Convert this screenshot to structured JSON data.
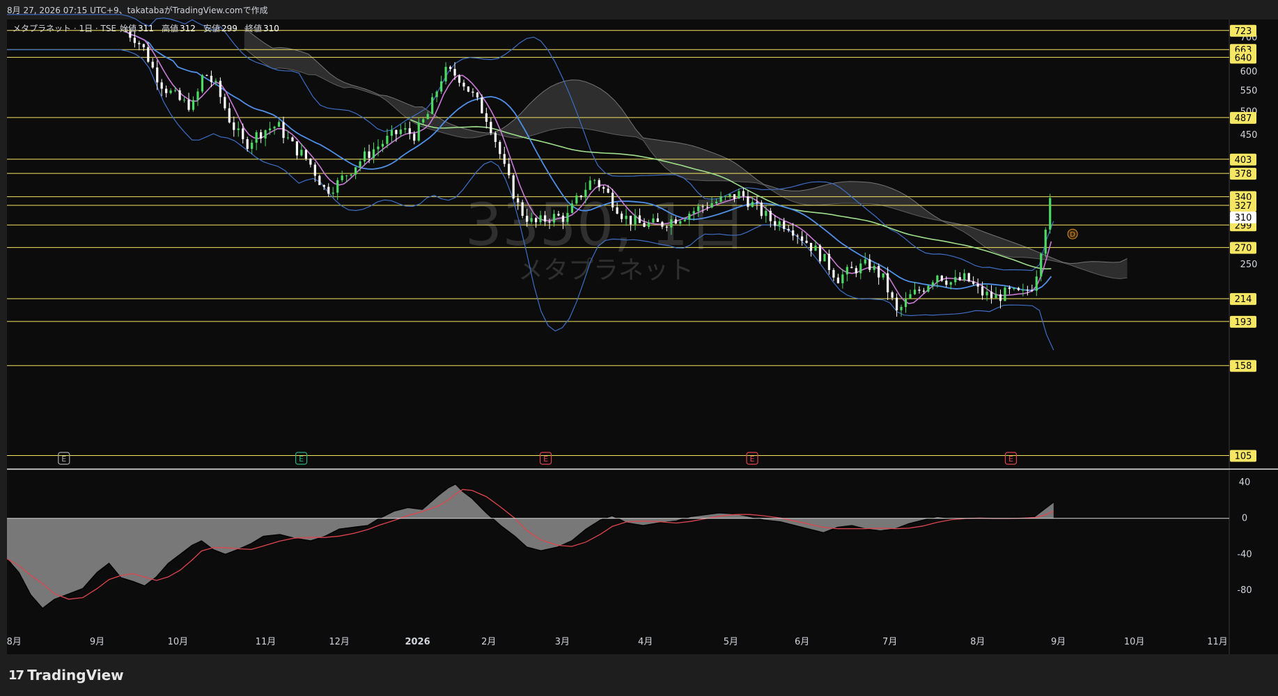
{
  "header": {
    "attribution": "8月 27, 2026 07:15 UTC+9、takatabaがTradingView.comで作成",
    "symbol_line": "メタプラネット · 1日 · TSE",
    "ohlc": [
      {
        "label": "始値",
        "value": "311"
      },
      {
        "label": "高値",
        "value": "312"
      },
      {
        "label": "安値",
        "value": "299"
      },
      {
        "label": "終値",
        "value": "310"
      }
    ]
  },
  "watermark": {
    "line1": "3350, 1日",
    "line2": "メタプラネット"
  },
  "brand": {
    "name": "TradingView",
    "mark": "17"
  },
  "colors": {
    "background": "#0c0c0c",
    "up": "#4cd964",
    "down": "#ffffff",
    "hline": "#f5e663",
    "ma_short": "#c97ad6",
    "ma_mid": "#4f8fe6",
    "ma_long": "#9fde8a",
    "bollinger": "#3e6fc6",
    "cloud": "#8a8a8a",
    "price_tag": "#f5e663",
    "earnings_pos": "#2bb07d",
    "earnings_neg": "#e0454f",
    "earnings_neutral": "#aaaaaa"
  },
  "chart_data": {
    "type": "candlestick",
    "price_axis": {
      "ticks": [
        700,
        600,
        550,
        500,
        450,
        250
      ],
      "min": 105,
      "max": 723,
      "scale": "log"
    },
    "horizontal_levels": [
      {
        "value": 723,
        "label": "723"
      },
      {
        "value": 663,
        "label": "663"
      },
      {
        "value": 640,
        "label": "640"
      },
      {
        "value": 487,
        "label": "487"
      },
      {
        "value": 403,
        "label": "403"
      },
      {
        "value": 378,
        "label": "378"
      },
      {
        "value": 340,
        "label": "340"
      },
      {
        "value": 327,
        "label": "327"
      },
      {
        "value": 299,
        "label": "299"
      },
      {
        "value": 270,
        "label": "270"
      },
      {
        "value": 214,
        "label": "214"
      },
      {
        "value": 193,
        "label": "193"
      },
      {
        "value": 158,
        "label": "158"
      },
      {
        "value": 105,
        "label": "105"
      }
    ],
    "current_price": {
      "value": 310,
      "label": "310"
    },
    "time_axis": {
      "labels": [
        "8月",
        "9月",
        "10月",
        "11月",
        "12月",
        "2026",
        "2月",
        "3月",
        "4月",
        "5月",
        "6月",
        "7月",
        "8月",
        "9月",
        "10月",
        "11月"
      ],
      "positions": [
        0.3,
        3.8,
        7.2,
        10.9,
        14.0,
        17.3,
        20.3,
        23.4,
        26.9,
        30.5,
        33.5,
        37.2,
        40.9,
        44.3,
        47.5,
        51.0
      ]
    },
    "earnings_markers": [
      {
        "t": 2.4,
        "type": "neutral",
        "label": "E"
      },
      {
        "t": 12.4,
        "type": "pos",
        "label": "E"
      },
      {
        "t": 22.7,
        "type": "neg",
        "label": "E"
      },
      {
        "t": 31.4,
        "type": "neg",
        "label": "E"
      },
      {
        "t": 42.3,
        "type": "neg",
        "label": "E"
      }
    ],
    "dividend_marker": {
      "t": 44.9,
      "label": "D"
    },
    "price_series": [
      [
        5.0,
        720
      ],
      [
        5.4,
        700
      ],
      [
        5.8,
        660
      ],
      [
        6.2,
        600
      ],
      [
        6.6,
        560
      ],
      [
        7.0,
        540
      ],
      [
        7.4,
        520
      ],
      [
        7.9,
        515
      ],
      [
        8.3,
        600
      ],
      [
        8.8,
        560
      ],
      [
        9.4,
        480
      ],
      [
        10.0,
        430
      ],
      [
        10.8,
        460
      ],
      [
        11.4,
        470
      ],
      [
        12.0,
        430
      ],
      [
        12.7,
        400
      ],
      [
        13.4,
        350
      ],
      [
        13.9,
        360
      ],
      [
        14.6,
        390
      ],
      [
        15.4,
        420
      ],
      [
        16.0,
        440
      ],
      [
        16.6,
        460
      ],
      [
        17.2,
        450
      ],
      [
        17.8,
        500
      ],
      [
        18.4,
        600
      ],
      [
        19.0,
        590
      ],
      [
        19.6,
        540
      ],
      [
        20.3,
        480
      ],
      [
        21.0,
        380
      ],
      [
        21.6,
        320
      ],
      [
        22.2,
        300
      ],
      [
        22.9,
        310
      ],
      [
        23.6,
        310
      ],
      [
        24.1,
        340
      ],
      [
        24.7,
        370
      ],
      [
        25.4,
        340
      ],
      [
        26.0,
        310
      ],
      [
        26.7,
        300
      ],
      [
        27.5,
        300
      ],
      [
        28.3,
        310
      ],
      [
        29.0,
        320
      ],
      [
        29.6,
        330
      ],
      [
        30.2,
        335
      ],
      [
        30.9,
        345
      ],
      [
        31.5,
        325
      ],
      [
        32.2,
        305
      ],
      [
        32.9,
        300
      ],
      [
        33.6,
        280
      ],
      [
        34.3,
        260
      ],
      [
        35.0,
        235
      ],
      [
        35.7,
        245
      ],
      [
        36.3,
        250
      ],
      [
        36.9,
        235
      ],
      [
        37.5,
        200
      ],
      [
        38.0,
        215
      ],
      [
        38.6,
        225
      ],
      [
        39.2,
        240
      ],
      [
        39.8,
        230
      ],
      [
        40.4,
        235
      ],
      [
        41.0,
        220
      ],
      [
        41.6,
        215
      ],
      [
        42.2,
        220
      ],
      [
        42.8,
        218
      ],
      [
        43.3,
        230
      ],
      [
        43.7,
        290
      ],
      [
        43.95,
        330
      ],
      [
        44.1,
        310
      ]
    ],
    "oscillator": {
      "ticks": [
        40,
        0,
        -40,
        -80
      ],
      "series": [
        [
          0.0,
          -45
        ],
        [
          0.5,
          -60
        ],
        [
          1.0,
          -85
        ],
        [
          1.5,
          -100
        ],
        [
          2.0,
          -90
        ],
        [
          2.6,
          -84
        ],
        [
          3.2,
          -78
        ],
        [
          3.8,
          -60
        ],
        [
          4.3,
          -50
        ],
        [
          4.8,
          -66
        ],
        [
          5.3,
          -70
        ],
        [
          5.8,
          -75
        ],
        [
          6.3,
          -65
        ],
        [
          6.8,
          -50
        ],
        [
          7.3,
          -40
        ],
        [
          7.8,
          -30
        ],
        [
          8.2,
          -25
        ],
        [
          8.7,
          -35
        ],
        [
          9.2,
          -40
        ],
        [
          9.7,
          -35
        ],
        [
          10.3,
          -28
        ],
        [
          10.8,
          -20
        ],
        [
          11.5,
          -18
        ],
        [
          12.1,
          -22
        ],
        [
          12.8,
          -25
        ],
        [
          13.4,
          -20
        ],
        [
          14.0,
          -12
        ],
        [
          14.6,
          -10
        ],
        [
          15.2,
          -8
        ],
        [
          15.7,
          0
        ],
        [
          16.3,
          8
        ],
        [
          16.9,
          12
        ],
        [
          17.5,
          10
        ],
        [
          18.2,
          26
        ],
        [
          18.6,
          34
        ],
        [
          18.9,
          38
        ],
        [
          19.2,
          30
        ],
        [
          19.6,
          22
        ],
        [
          20.2,
          6
        ],
        [
          20.8,
          -8
        ],
        [
          21.4,
          -20
        ],
        [
          21.9,
          -32
        ],
        [
          22.5,
          -36
        ],
        [
          23.2,
          -32
        ],
        [
          23.8,
          -25
        ],
        [
          24.4,
          -12
        ],
        [
          25.0,
          -2
        ],
        [
          25.5,
          3
        ],
        [
          26.1,
          -5
        ],
        [
          26.8,
          -8
        ],
        [
          27.5,
          -5
        ],
        [
          28.2,
          -3
        ],
        [
          28.8,
          2
        ],
        [
          29.4,
          4
        ],
        [
          30.0,
          6
        ],
        [
          30.7,
          5
        ],
        [
          31.3,
          2
        ],
        [
          31.9,
          -2
        ],
        [
          32.6,
          -4
        ],
        [
          33.2,
          -8
        ],
        [
          33.8,
          -12
        ],
        [
          34.4,
          -16
        ],
        [
          35.0,
          -10
        ],
        [
          35.6,
          -8
        ],
        [
          36.2,
          -12
        ],
        [
          36.8,
          -14
        ],
        [
          37.4,
          -12
        ],
        [
          38.0,
          -6
        ],
        [
          38.6,
          -2
        ],
        [
          39.2,
          2
        ],
        [
          39.8,
          0
        ],
        [
          40.4,
          -1
        ],
        [
          41.0,
          0
        ],
        [
          41.6,
          0
        ],
        [
          42.2,
          0
        ],
        [
          42.8,
          1
        ],
        [
          43.3,
          2
        ],
        [
          43.7,
          10
        ],
        [
          44.1,
          18
        ]
      ]
    }
  }
}
